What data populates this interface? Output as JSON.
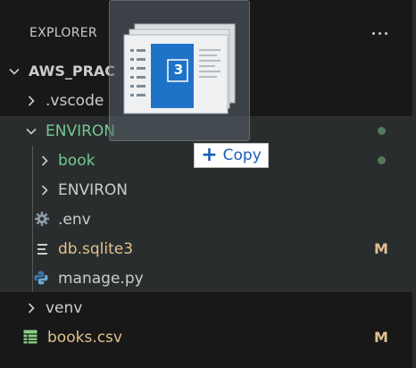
{
  "explorer": {
    "title": "EXPLORER",
    "more_icon": "ellipsis-icon"
  },
  "tree": {
    "root": {
      "label": "AWS_PRAC",
      "expanded": true
    },
    "items": [
      {
        "label": ".vscode",
        "kind": "folder",
        "expanded": false,
        "color": "#cccccc"
      },
      {
        "label": "ENVIRON",
        "kind": "folder",
        "expanded": true,
        "color": "#73c991",
        "status": "dot"
      },
      {
        "label": "book",
        "kind": "folder",
        "expanded": false,
        "color": "#73c991",
        "status": "dot"
      },
      {
        "label": "ENVIRON",
        "kind": "folder",
        "expanded": false,
        "color": "#cccccc"
      },
      {
        "label": ".env",
        "kind": "file",
        "icon": "gear-icon",
        "color": "#cccccc"
      },
      {
        "label": "db.sqlite3",
        "kind": "file",
        "icon": "lines-icon",
        "color": "#e2c08d",
        "badge": "M"
      },
      {
        "label": "manage.py",
        "kind": "file",
        "icon": "python-icon",
        "color": "#cccccc"
      },
      {
        "label": "venv",
        "kind": "folder",
        "expanded": false,
        "color": "#cccccc"
      },
      {
        "label": "books.csv",
        "kind": "file",
        "icon": "csv-table-icon",
        "color": "#e2c08d",
        "badge": "M"
      }
    ]
  },
  "drag": {
    "count": "3",
    "copy_label": "Copy"
  }
}
